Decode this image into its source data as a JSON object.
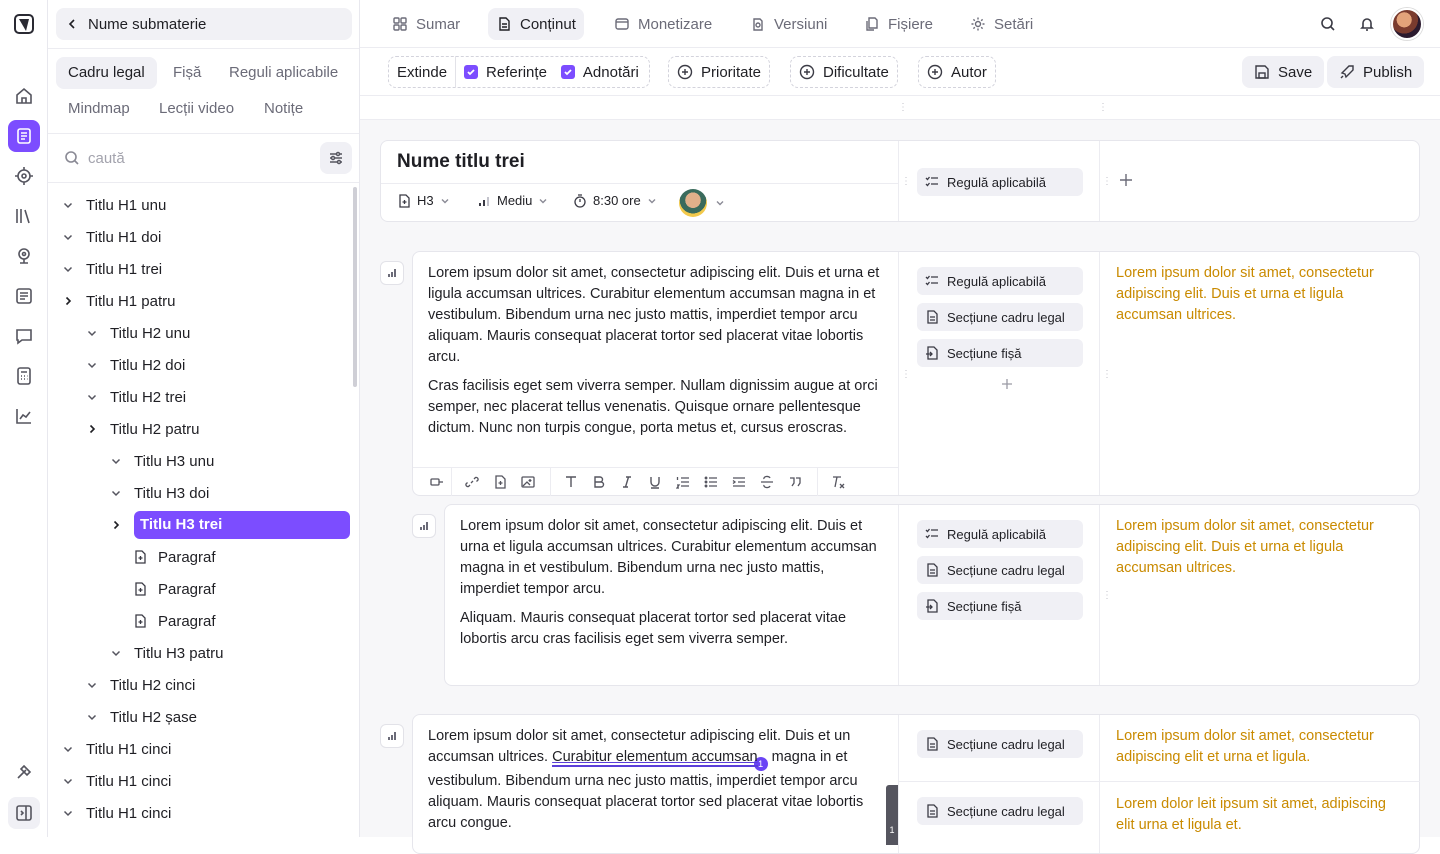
{
  "rail": {
    "top": [
      "logo-icon"
    ],
    "items": [
      "home-icon",
      "book-icon",
      "target-icon",
      "library-icon",
      "webcam-icon",
      "newspaper-icon",
      "chat-icon",
      "calculator-icon",
      "chart-icon"
    ],
    "bottom": [
      "hammer-icon",
      "sidebar-toggle-icon"
    ]
  },
  "sidebar": {
    "back_label": "Nume submaterie",
    "tabs": [
      "Cadru legal",
      "Fișă",
      "Reguli aplicabile",
      "Mindmap",
      "Lecții video",
      "Notițe"
    ],
    "search_placeholder": "caută",
    "tree": [
      {
        "label": "Titlu H1 unu",
        "level": 0,
        "chev": "down"
      },
      {
        "label": "Titlu H1 doi",
        "level": 0,
        "chev": "down"
      },
      {
        "label": "Titlu H1 trei",
        "level": 0,
        "chev": "down"
      },
      {
        "label": "Titlu H1 patru",
        "level": 0,
        "chev": "right"
      },
      {
        "label": "Titlu H2 unu",
        "level": 1,
        "chev": "down"
      },
      {
        "label": "Titlu H2 doi",
        "level": 1,
        "chev": "down"
      },
      {
        "label": "Titlu H2 trei",
        "level": 1,
        "chev": "down"
      },
      {
        "label": "Titlu H2 patru",
        "level": 1,
        "chev": "right"
      },
      {
        "label": "Titlu H3 unu",
        "level": 2,
        "chev": "down"
      },
      {
        "label": "Titlu H3 doi",
        "level": 2,
        "chev": "down"
      },
      {
        "label": "Titlu H3 trei",
        "level": 2,
        "chev": "right",
        "selected": true
      },
      {
        "label": "Paragraf",
        "level": 3,
        "chev": "doc"
      },
      {
        "label": "Paragraf",
        "level": 3,
        "chev": "doc"
      },
      {
        "label": "Paragraf",
        "level": 3,
        "chev": "doc"
      },
      {
        "label": "Titlu H3 patru",
        "level": 2,
        "chev": "down"
      },
      {
        "label": "Titlu H2 cinci",
        "level": 1,
        "chev": "down"
      },
      {
        "label": "Titlu H2 șase",
        "level": 1,
        "chev": "down"
      },
      {
        "label": "Titlu H1 cinci",
        "level": 0,
        "chev": "down"
      },
      {
        "label": "Titlu H1 cinci",
        "level": 0,
        "chev": "down"
      },
      {
        "label": "Titlu H1 cinci",
        "level": 0,
        "chev": "down"
      }
    ]
  },
  "topnav": {
    "tabs": [
      {
        "label": "Sumar",
        "icon": "grid-icon"
      },
      {
        "label": "Conținut",
        "icon": "document-icon",
        "active": true
      },
      {
        "label": "Monetizare",
        "icon": "wallet-icon"
      },
      {
        "label": "Versiuni",
        "icon": "versions-icon"
      },
      {
        "label": "Fișiere",
        "icon": "files-icon"
      },
      {
        "label": "Setări",
        "icon": "gear-icon"
      }
    ]
  },
  "toolbar": {
    "extinde": "Extinde",
    "referinte": "Referințe",
    "adnotari": "Adnotări",
    "prioritate": "Prioritate",
    "dificultate": "Dificultate",
    "autor": "Autor",
    "save": "Save",
    "publish": "Publish"
  },
  "header_card": {
    "title": "Nume titlu trei",
    "level": "H3",
    "difficulty": "Mediu",
    "duration": "8:30 ore",
    "rule_tag": "Regulă aplicabilă"
  },
  "tags": {
    "rule": "Regulă aplicabilă",
    "legal": "Secțiune cadru legal",
    "sheet": "Secțiune fișă"
  },
  "block1": {
    "p1": "Lorem ipsum dolor sit amet, consectetur adipiscing elit. Duis et urna et ligula accumsan ultrices. Curabitur elementum accumsan magna in et vestibulum. Bibendum urna nec justo mattis, imperdiet tempor arcu aliquam. Mauris consequat placerat tortor sed placerat vitae lobortis arcu.",
    "p2": "Cras facilisis eget sem viverra semper. Nullam dignissim augue at orci semper, nec placerat tellus venenatis. Quisque ornare pellentesque dictum. Nunc non turpis congue, porta metus et, cursus eroscras.",
    "note": "Lorem ipsum dolor sit amet, consectetur adipiscing elit. Duis et urna et ligula accumsan ultrices."
  },
  "block2": {
    "p1": "Lorem ipsum dolor sit amet, consectetur adipiscing elit. Duis et urna et ligula accumsan ultrices. Curabitur elementum accumsan magna in et vestibulum. Bibendum urna nec justo mattis, imperdiet tempor arcu.",
    "p2": "Aliquam. Mauris consequat placerat tortor sed placerat vitae lobortis arcu cras facilisis eget sem viverra semper.",
    "note": "Lorem ipsum dolor sit amet, consectetur adipiscing elit. Duis et urna et ligula accumsan ultrices."
  },
  "block3": {
    "p_a": "Lorem ipsum dolor sit amet, consectetur adipiscing elit. Duis et un accumsan ultrices. ",
    "p_link": "Curabitur elementum accumsan",
    "p_b": " magna in et vestibulum. Bibendum urna nec justo mattis, imperdiet tempor arcu aliquam. Mauris consequat placerat tortor sed placerat vitae lobortis arcu congue.",
    "badge": "1",
    "note1": "Lorem ipsum dolor sit amet, consectetur adipiscing elit et urna et ligula.",
    "note2": "Lorem dolor leit ipsum sit amet, adipiscing elit urna et ligula et.",
    "marker": "1"
  },
  "colors": {
    "accent": "#7c4dff",
    "note": "#c98a00"
  }
}
